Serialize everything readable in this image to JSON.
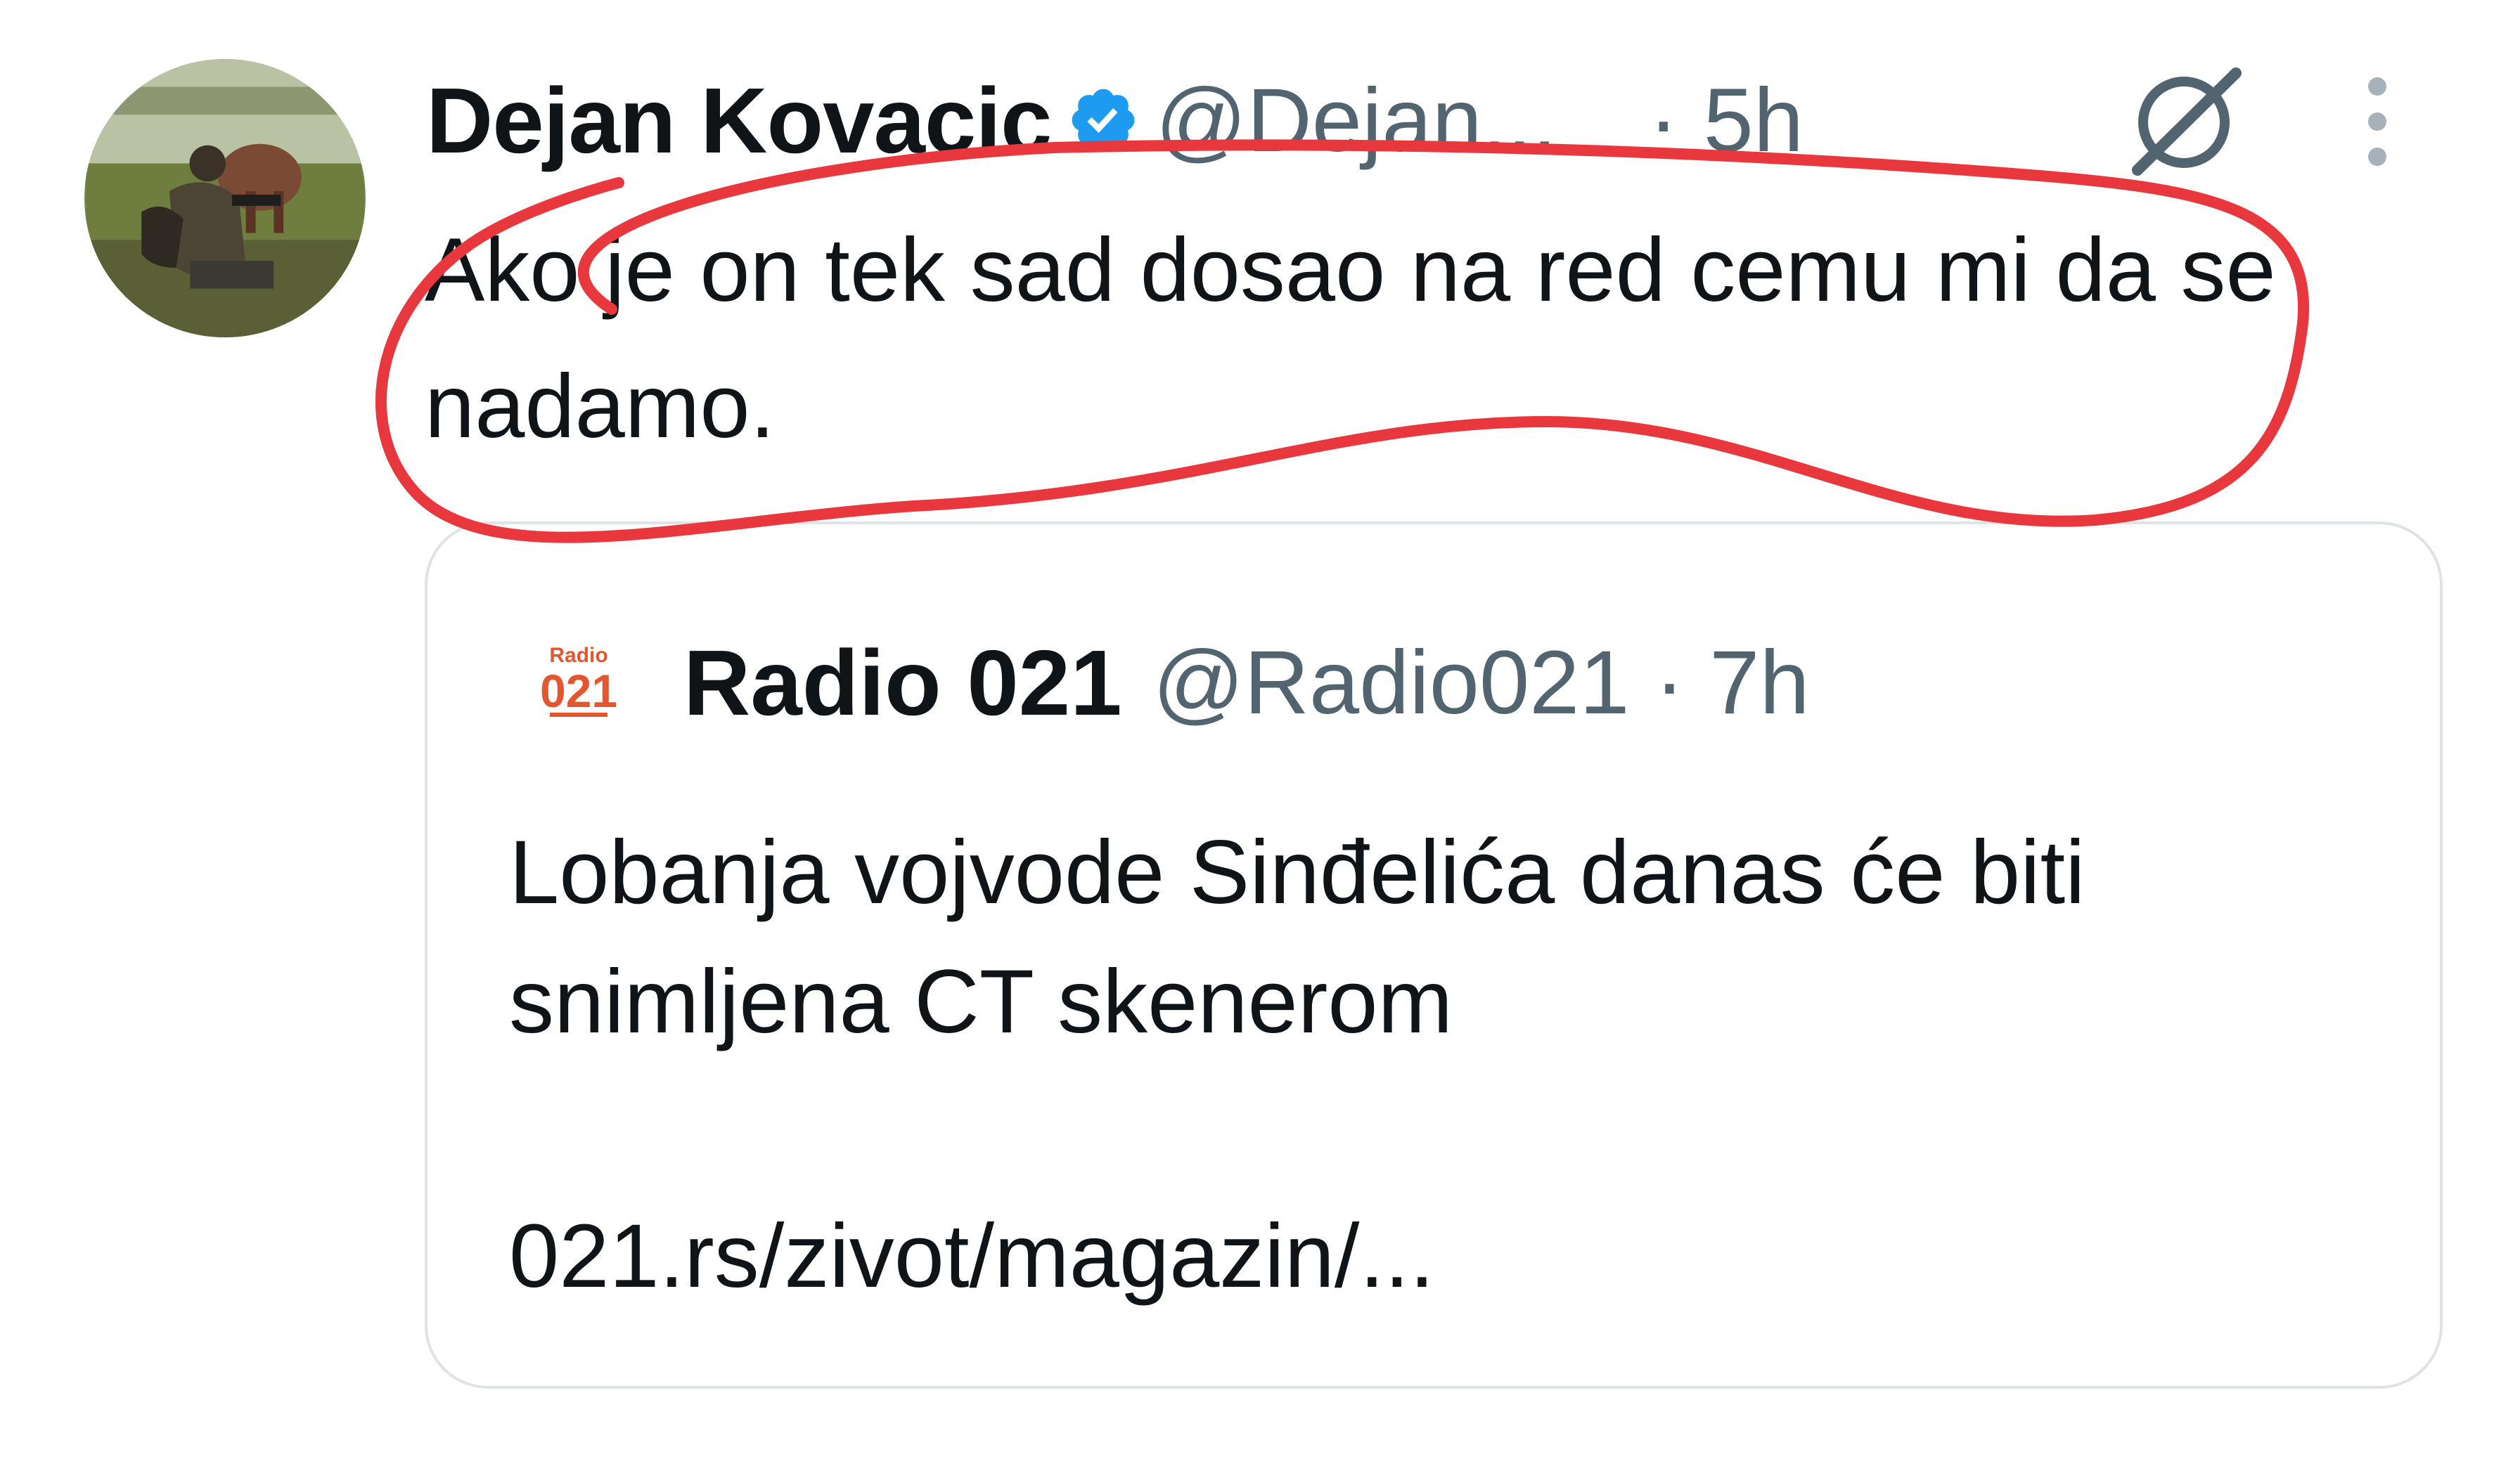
{
  "tweet": {
    "author_name": "Dejan Kovacic",
    "handle": "@Dejan...",
    "time": "· 5h",
    "text": "Ako je on tek sad dosao na red cemu mi da se nadamo.",
    "icons": {
      "avatar": "user-photo-avatar",
      "verified": "verified-badge-icon",
      "grok": "grok-icon",
      "more": "more-vertical-icon"
    }
  },
  "quote": {
    "author_name": "Radio 021",
    "handle_time": "@Radio021 · 7h",
    "logo_text_top": "Radio",
    "logo_text_main": "021",
    "text": "Lobanja vojvode Sinđelića danas će biti snimljena CT skenerom",
    "link": "021.rs/zivot/magazin/..."
  },
  "colors": {
    "text": "#0f1419",
    "muted": "#536471",
    "verified": "#1d9bf0",
    "annotation": "#e8383d",
    "radio_brand": "#e4572e",
    "card_border": "#dfe3e6"
  }
}
